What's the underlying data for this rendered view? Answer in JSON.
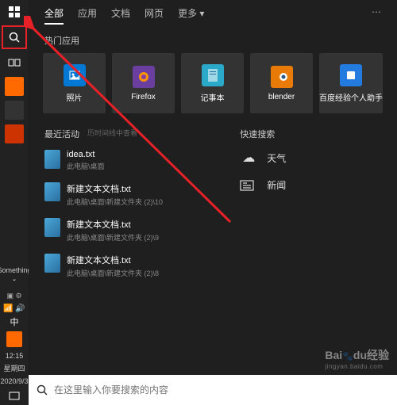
{
  "taskbar": {
    "top_icons": [
      "windows",
      "search",
      "task-view"
    ],
    "status_label": "Something",
    "ime": "中",
    "clock": {
      "time": "12:15",
      "day": "星期四",
      "date": "2020/9/3"
    }
  },
  "tabs": [
    "全部",
    "应用",
    "文档",
    "网页",
    "更多 ▾"
  ],
  "active_tab": 0,
  "top_apps": {
    "title": "热门应用",
    "items": [
      {
        "label": "照片",
        "icon": "photos"
      },
      {
        "label": "Firefox",
        "icon": "firefox"
      },
      {
        "label": "记事本",
        "icon": "notepad"
      },
      {
        "label": "blender",
        "icon": "blender"
      },
      {
        "label": "百度经验个人助手",
        "icon": "baidu-helper"
      }
    ]
  },
  "recent": {
    "title": "最近活动",
    "subtitle": "历时间线中查看",
    "items": [
      {
        "name": "idea.txt",
        "path": "此电脑\\桌面"
      },
      {
        "name": "新建文本文档.txt",
        "path": "此电脑\\桌面\\新建文件夹 (2)\\10"
      },
      {
        "name": "新建文本文档.txt",
        "path": "此电脑\\桌面\\新建文件夹 (2)\\9"
      },
      {
        "name": "新建文本文档.txt",
        "path": "此电脑\\桌面\\新建文件夹 (2)\\8"
      }
    ]
  },
  "quick": {
    "title": "快速搜索",
    "items": [
      {
        "label": "天气",
        "icon": "weather"
      },
      {
        "label": "新闻",
        "icon": "news"
      }
    ]
  },
  "search_placeholder": "在这里输入你要搜索的内容",
  "watermark": {
    "brand": "Bai",
    "brand2": "du",
    "brand3": "经验",
    "url": "jingyan.baidu.com"
  }
}
